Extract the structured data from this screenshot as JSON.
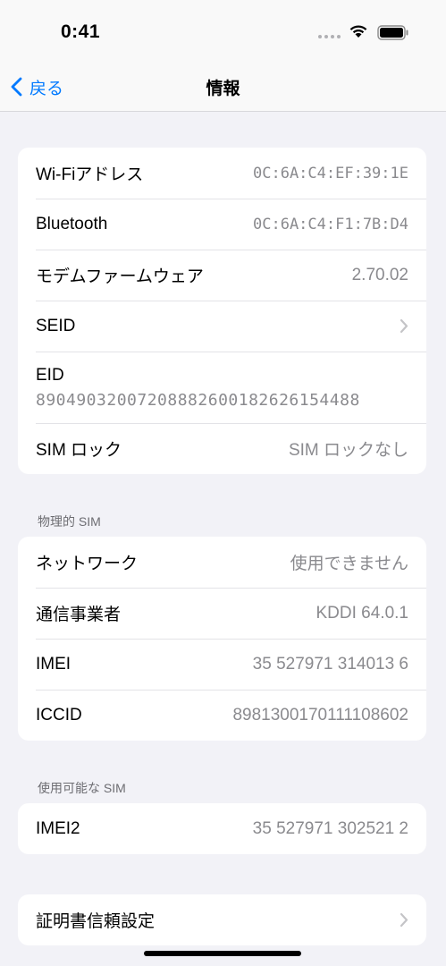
{
  "status_bar": {
    "time": "0:41"
  },
  "nav": {
    "back_label": "戻る",
    "title": "情報"
  },
  "group1": [
    {
      "label": "Wi-Fiアドレス",
      "value": "0C:6A:C4:EF:39:1E"
    },
    {
      "label": "Bluetooth",
      "value": "0C:6A:C4:F1:7B:D4"
    },
    {
      "label": "モデムファームウェア",
      "value": "2.70.02"
    },
    {
      "label": "SEID"
    },
    {
      "label": "EID",
      "value": "89049032007208882600182626154488"
    },
    {
      "label": "SIM ロック",
      "value": "SIM ロックなし"
    }
  ],
  "section_physical": {
    "header": "物理的 SIM"
  },
  "group2": [
    {
      "label": "ネットワーク",
      "value": "使用できません"
    },
    {
      "label": "通信事業者",
      "value": "KDDI 64.0.1"
    },
    {
      "label": "IMEI",
      "value": "35 527971 314013 6"
    },
    {
      "label": "ICCID",
      "value": "8981300170111108602"
    }
  ],
  "section_available": {
    "header": "使用可能な SIM"
  },
  "group3": [
    {
      "label": "IMEI2",
      "value": "35 527971 302521 2"
    }
  ],
  "group4": [
    {
      "label": "証明書信頼設定"
    }
  ],
  "colors": {
    "accent": "#007aff",
    "secondary_text": "#8a8a8e",
    "background": "#f2f2f7"
  }
}
